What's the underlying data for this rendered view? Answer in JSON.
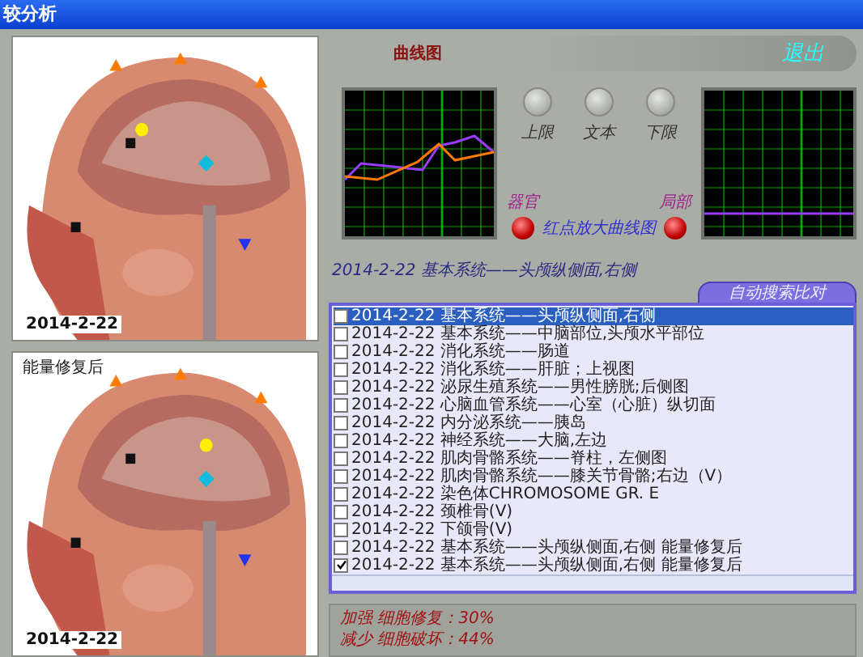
{
  "window": {
    "title": "较分析"
  },
  "images": [
    {
      "date": "2014-2-22"
    },
    {
      "caption": "能量修复后",
      "date": "2014-2-22"
    }
  ],
  "header": {
    "title": "曲线图",
    "exit_button": "退出"
  },
  "controls": {
    "buttons": [
      {
        "label": "上限"
      },
      {
        "label": "文本"
      },
      {
        "label": "下限"
      }
    ],
    "lamps": [
      {
        "label": "器官"
      },
      {
        "label": "局部"
      }
    ],
    "hint": "红点放大曲线图"
  },
  "status": "2014-2-22 基本系统——头颅纵侧面,右侧",
  "tab": "自动搜索比对",
  "records": [
    {
      "text": "2014-2-22 基本系统——头颅纵侧面,右侧",
      "checked": false,
      "selected": true
    },
    {
      "text": "2014-2-22 基本系统——中脑部位,头颅水平部位",
      "checked": false,
      "selected": false
    },
    {
      "text": "2014-2-22 消化系统——肠道",
      "checked": false,
      "selected": false
    },
    {
      "text": "2014-2-22 消化系统——肝脏；上视图",
      "checked": false,
      "selected": false
    },
    {
      "text": "2014-2-22 泌尿生殖系统——男性膀胱;后侧图",
      "checked": false,
      "selected": false
    },
    {
      "text": "2014-2-22 心脑血管系统——心室（心脏）纵切面",
      "checked": false,
      "selected": false
    },
    {
      "text": "2014-2-22 内分泌系统——胰岛",
      "checked": false,
      "selected": false
    },
    {
      "text": "2014-2-22 神经系统——大脑,左边",
      "checked": false,
      "selected": false
    },
    {
      "text": "2014-2-22 肌肉骨骼系统——脊柱，左侧图",
      "checked": false,
      "selected": false
    },
    {
      "text": "2014-2-22 肌肉骨骼系统——膝关节骨骼;右边（V）",
      "checked": false,
      "selected": false
    },
    {
      "text": "2014-2-22 染色体CHROMOSOME GR. E",
      "checked": false,
      "selected": false
    },
    {
      "text": "2014-2-22 颈椎骨(V)",
      "checked": false,
      "selected": false
    },
    {
      "text": "2014-2-22 下颌骨(V)",
      "checked": false,
      "selected": false
    },
    {
      "text": "2014-2-22 基本系统——头颅纵侧面,右侧 能量修复后",
      "checked": false,
      "selected": false
    },
    {
      "text": "2014-2-22 基本系统——头颅纵侧面,右侧 能量修复后",
      "checked": true,
      "selected": false
    }
  ],
  "summary": [
    "加强 细胞修复：30%",
    "减少 细胞破坏：44%"
  ]
}
